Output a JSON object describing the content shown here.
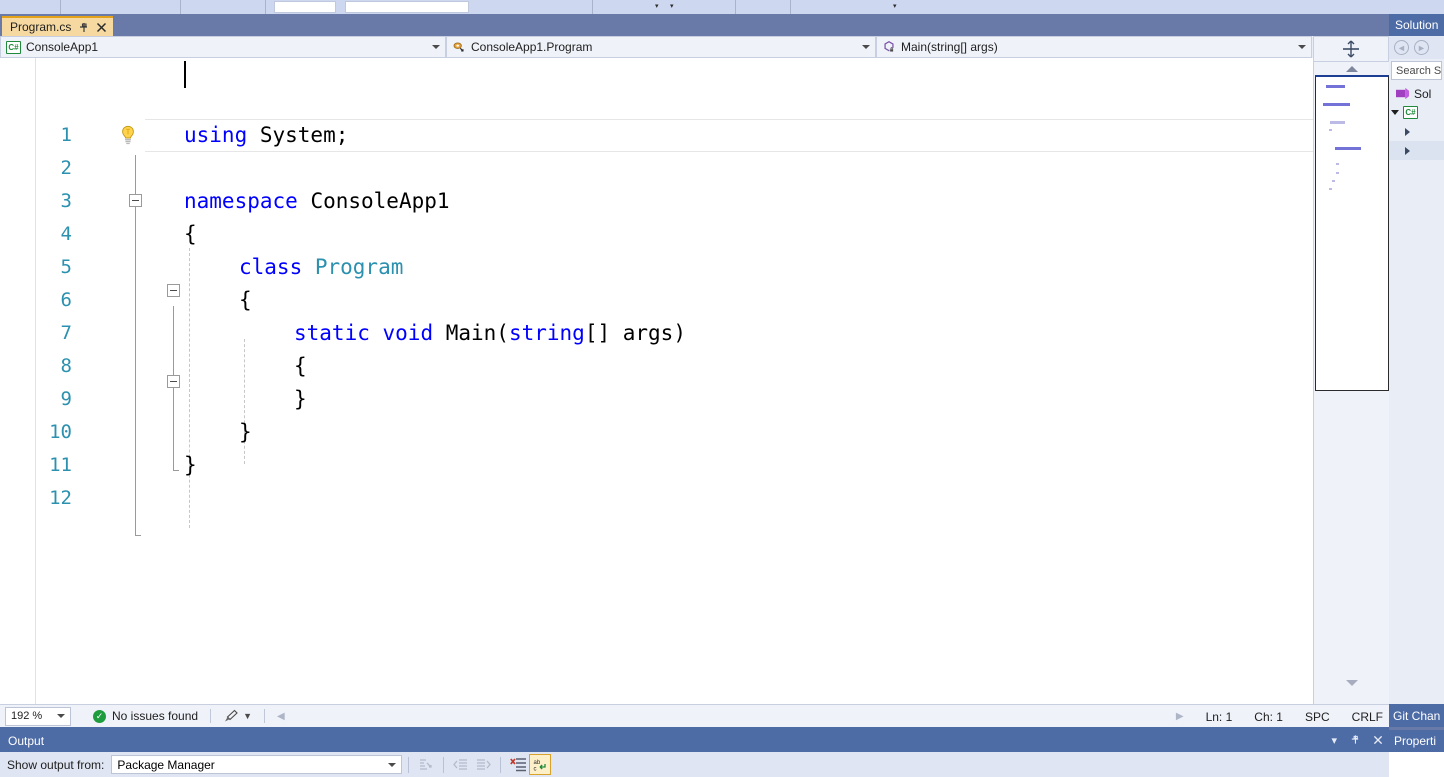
{
  "window": {
    "theme_accent": "#4d6ba5",
    "tab_accent": "#e3a21a"
  },
  "document_tab": {
    "name": "Program.cs",
    "pin_icon": "pin-icon",
    "close_icon": "close-icon",
    "tab_list_icon": "chevron-down-icon",
    "settings_icon": "gear-icon"
  },
  "navigation_bar": {
    "project": "ConsoleApp1",
    "project_icon": "csharp-project-icon",
    "type": "ConsoleApp1.Program",
    "type_icon": "class-icon",
    "member": "Main(string[] args)",
    "member_icon": "method-private-icon",
    "split_view_icon": "split-window-icon"
  },
  "editor": {
    "language": "csharp",
    "quick_actions_icon": "lightbulb-icon",
    "colors": {
      "line_number": "#2b91af",
      "keyword": "#0000ff",
      "type_name": "#2b91af",
      "plain_text": "#000000",
      "background": "#ffffff"
    },
    "lines": [
      {
        "n": "1",
        "indent": 0,
        "tokens": [
          {
            "t": "using ",
            "c": "kw"
          },
          {
            "t": "System;",
            "c": "plain"
          }
        ]
      },
      {
        "n": "2",
        "indent": 0,
        "tokens": []
      },
      {
        "n": "3",
        "indent": 0,
        "tokens": [
          {
            "t": "namespace ",
            "c": "kw"
          },
          {
            "t": "ConsoleApp1",
            "c": "plain"
          }
        ]
      },
      {
        "n": "4",
        "indent": 0,
        "tokens": [
          {
            "t": "{",
            "c": "plain"
          }
        ]
      },
      {
        "n": "5",
        "indent": 1,
        "tokens": [
          {
            "t": "class ",
            "c": "kw"
          },
          {
            "t": "Program",
            "c": "typ"
          }
        ]
      },
      {
        "n": "6",
        "indent": 1,
        "tokens": [
          {
            "t": "{",
            "c": "plain"
          }
        ]
      },
      {
        "n": "7",
        "indent": 2,
        "tokens": [
          {
            "t": "static ",
            "c": "kw"
          },
          {
            "t": "void ",
            "c": "kw"
          },
          {
            "t": "Main(",
            "c": "plain"
          },
          {
            "t": "string",
            "c": "kw"
          },
          {
            "t": "[] args)",
            "c": "plain"
          }
        ]
      },
      {
        "n": "8",
        "indent": 2,
        "tokens": [
          {
            "t": "{",
            "c": "plain"
          }
        ]
      },
      {
        "n": "9",
        "indent": 2,
        "tokens": [
          {
            "t": "}",
            "c": "plain"
          }
        ]
      },
      {
        "n": "10",
        "indent": 1,
        "tokens": [
          {
            "t": "}",
            "c": "plain"
          }
        ]
      },
      {
        "n": "11",
        "indent": 0,
        "tokens": [
          {
            "t": "}",
            "c": "plain"
          }
        ]
      },
      {
        "n": "12",
        "indent": 0,
        "tokens": []
      }
    ]
  },
  "status_bar": {
    "zoom": "192 %",
    "issues": "No issues found",
    "issues_icon": "check-circle-icon",
    "brush_icon": "code-cleanup-icon",
    "line": "Ln: 1",
    "column": "Ch: 1",
    "indent": "SPC",
    "line_endings": "CRLF",
    "git_changes": "Git Chan"
  },
  "output_window": {
    "title": "Output",
    "source_label": "Show output from:",
    "source_value": "Package Manager",
    "toolbar_icons": [
      "find-message-icon",
      "go-to-previous-message-icon",
      "go-to-next-message-icon",
      "clear-all-icon",
      "toggle-word-wrap-icon"
    ],
    "header_buttons": [
      "chevron-down-icon",
      "pin-icon",
      "close-icon"
    ]
  },
  "solution_explorer": {
    "title": "Solution",
    "search_placeholder": "Search S",
    "back_icon": "navigate-back-icon",
    "forward_icon": "navigate-forward-icon",
    "solution_node": "Sol",
    "project_node_icon": "csharp-project-icon"
  },
  "properties_panel": {
    "title": "Properti"
  }
}
